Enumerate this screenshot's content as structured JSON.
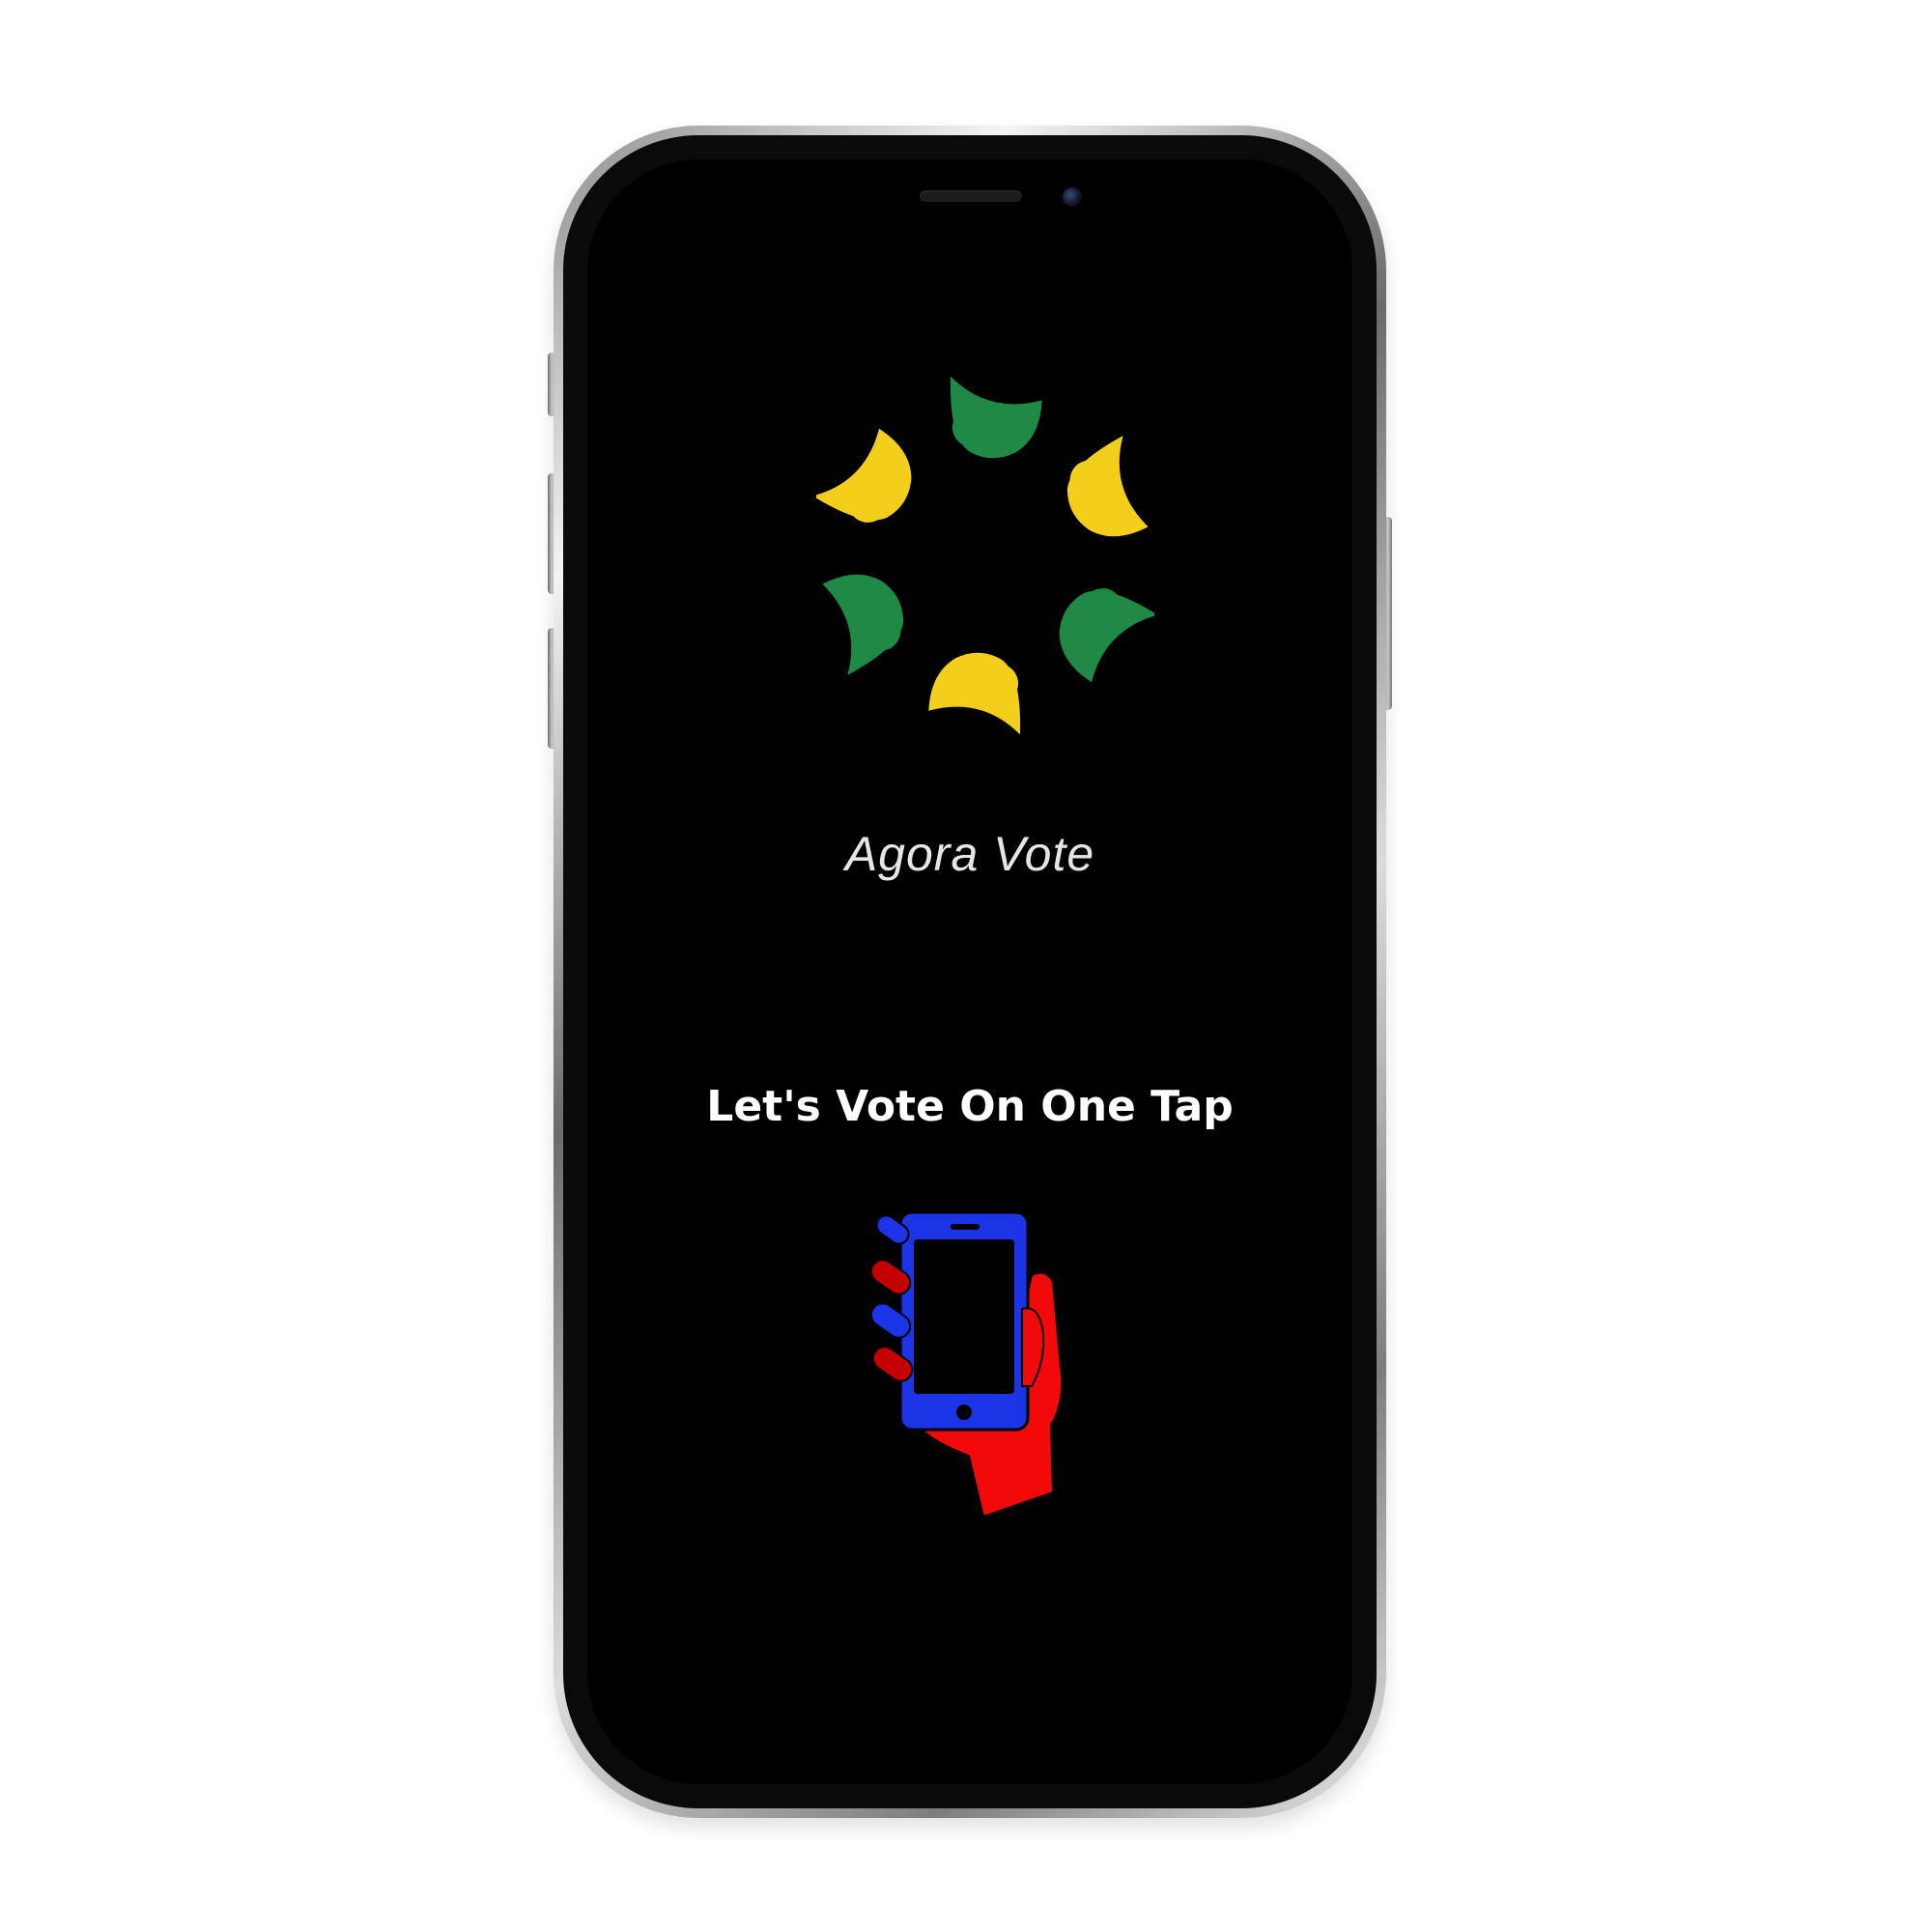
{
  "app": {
    "title": "Agora Vote",
    "tagline": "Let's Vote On One Tap"
  },
  "icons": {
    "logo": "people-circle-logo-icon",
    "tap": "hand-holding-phone-icon"
  },
  "colors": {
    "screen_background": "#000000",
    "logo_green": "#1e8a45",
    "logo_yellow": "#f3cf1c",
    "phone_blue": "#1a34e6",
    "hand_red": "#f20a0a",
    "title_text": "#e6e6e6",
    "tagline_text": "#ffffff"
  }
}
